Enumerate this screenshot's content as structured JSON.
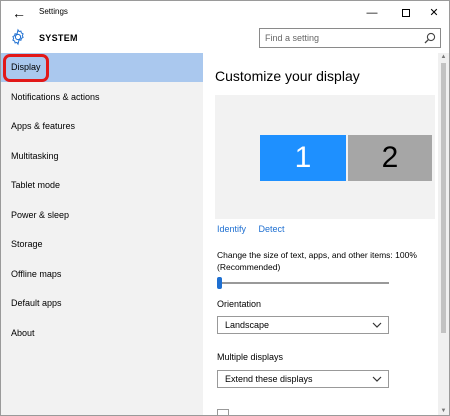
{
  "window": {
    "title": "Settings"
  },
  "header": {
    "section_title": "SYSTEM",
    "search_placeholder": "Find a setting"
  },
  "sidebar": {
    "items": [
      {
        "label": "Display",
        "active": true
      },
      {
        "label": "Notifications & actions"
      },
      {
        "label": "Apps & features"
      },
      {
        "label": "Multitasking"
      },
      {
        "label": "Tablet mode"
      },
      {
        "label": "Power & sleep"
      },
      {
        "label": "Storage"
      },
      {
        "label": "Offline maps"
      },
      {
        "label": "Default apps"
      },
      {
        "label": "About"
      }
    ]
  },
  "main": {
    "title": "Customize your display",
    "monitors": [
      {
        "label": "1",
        "selected": true,
        "color": "#1e90ff"
      },
      {
        "label": "2",
        "selected": false,
        "color": "#a6a6a6"
      }
    ],
    "links": {
      "identify": "Identify",
      "detect": "Detect"
    },
    "scaling": {
      "label": "Change the size of text, apps, and other items: 100% (Recommended)",
      "value_fraction": 0.0
    },
    "orientation": {
      "label": "Orientation",
      "value": "Landscape"
    },
    "multiple_displays": {
      "label": "Multiple displays",
      "value": "Extend these displays"
    }
  },
  "colors": {
    "accent": "#1e6fd1",
    "active_nav": "#aac8ee",
    "highlight_ring": "#e21818"
  }
}
